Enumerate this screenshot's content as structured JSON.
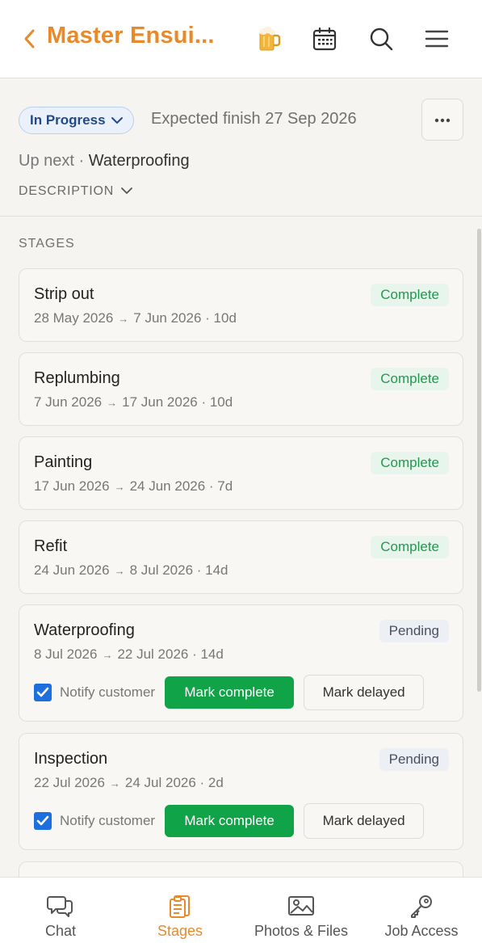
{
  "header": {
    "title": "Master Ensui...",
    "icons": [
      "back-chevron-icon",
      "beer-mug-icon",
      "calendar-icon",
      "search-icon",
      "menu-icon"
    ]
  },
  "job": {
    "status": "In Progress",
    "expected_finish": "Expected finish 27 Sep 2026",
    "up_next_label": "Up next",
    "up_next_sep": "·",
    "up_next_value": "Waterproofing",
    "description_label": "DESCRIPTION"
  },
  "stages_label": "STAGES",
  "stages": [
    {
      "name": "Strip out",
      "start": "28 May 2026",
      "arrow": "→",
      "end": "7 Jun 2026 · 10d",
      "status": "Complete"
    },
    {
      "name": "Replumbing",
      "start": "7 Jun 2026",
      "arrow": "→",
      "end": "17 Jun 2026 · 10d",
      "status": "Complete"
    },
    {
      "name": "Painting",
      "start": "17 Jun 2026",
      "arrow": "→",
      "end": "24 Jun 2026 · 7d",
      "status": "Complete"
    },
    {
      "name": "Refit",
      "start": "24 Jun 2026",
      "arrow": "→",
      "end": "8 Jul 2026 · 14d",
      "status": "Complete"
    },
    {
      "name": "Waterproofing",
      "start": "8 Jul 2026",
      "arrow": "→",
      "end": "22 Jul 2026 · 14d",
      "status": "Pending",
      "notify_label": "Notify customer",
      "notify_checked": true,
      "complete_label": "Mark complete",
      "delayed_label": "Mark delayed"
    },
    {
      "name": "Inspection",
      "start": "22 Jul 2026",
      "arrow": "→",
      "end": "24 Jul 2026 · 2d",
      "status": "Pending",
      "notify_label": "Notify customer",
      "notify_checked": true,
      "complete_label": "Mark complete",
      "delayed_label": "Mark delayed"
    }
  ],
  "nav": {
    "items": [
      {
        "label": "Chat",
        "icon": "chat-icon"
      },
      {
        "label": "Stages",
        "icon": "stages-clipboard-icon",
        "active": true
      },
      {
        "label": "Photos & Files",
        "icon": "image-icon"
      },
      {
        "label": "Job Access",
        "icon": "key-icon"
      }
    ]
  },
  "colors": {
    "accent": "#e8892a",
    "complete_green": "#1f9a4d",
    "button_green": "#10a348",
    "checkbox_blue": "#1d6fe0",
    "status_pill_text": "#244a86"
  }
}
